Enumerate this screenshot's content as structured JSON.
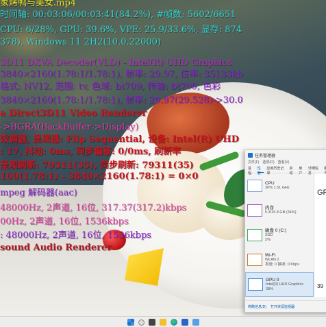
{
  "osd": {
    "lines": [
      {
        "text": "家烤鸭与美女.mp4",
        "color": "yellow"
      },
      {
        "text": "时间轴: 00:03:06/00:03:41(84.2%), #帧数: 5602/6651",
        "color": "cyan"
      },
      {
        "text": "CPU: 6/28%, GPU: 39.6%, VPE: 25.9/33.6%, 显存: 874",
        "color": "cyan"
      },
      {
        "text": "378), Windows 11 2H2(10.0.22000)",
        "color": "cyan"
      },
      {
        "text": "3D11 DXVA Decoder(VLD) - Intel(R) UHD Graphics",
        "color": "magenta"
      },
      {
        "text": "3840×2160(1.78:1/1.78:1), 帧率: 29.97, 位率: 35133kb",
        "color": "purple"
      },
      {
        "text": "格式: NV12, 范围: tv, 色域: bt709, 传输: bt709, 色彩",
        "color": "purple"
      },
      {
        "text": "3840×2160(1.78:1/1.78:1), 帧率: 29.97(29.528)->30.0",
        "color": "purple"
      },
      {
        "text": "a Direct3D11 Video Renderer",
        "color": "red"
      },
      {
        "text": "->BGRA(BackBuffer->Display)",
        "color": "pink"
      },
      {
        "text": "效调器, 呈现器: Flip Sequential, 设备: Intel(R) UHD",
        "color": "red"
      },
      {
        "text": ": 17, 抖动: 0ms, 同步偏移: 0/0ms, 刷新率",
        "color": "red"
      },
      {
        "text": "呈现刷新: 79311(35), 同步刷新: 79311(35)",
        "color": "red"
      },
      {
        "text": "160(1.78:1) - 3840×2160(1.78:1) = 0×0",
        "color": "red"
      },
      {
        "text": "mpeg 解码器(aac)",
        "color": "purple"
      },
      {
        "text": "48000Hz, 2声道, 16位, 317.37(317.2)kbps",
        "color": "pink"
      },
      {
        "text": "00Hz, 2声道, 16位, 1536kbps",
        "color": "pink"
      },
      {
        "text": ": 48000Hz, 2声道, 16位, 1536kbps",
        "color": "purple"
      },
      {
        "text": "sound Audio Renderer",
        "color": "dark"
      }
    ]
  },
  "task_manager": {
    "title": "任务管理器",
    "menu": [
      "文件(F)",
      "选项(O)",
      "查看(V)"
    ],
    "tabs": [
      "进程",
      "性能",
      "应用历史记录",
      "启动",
      "用户",
      "详细信息",
      "服务"
    ],
    "active_tab_index": 1,
    "items": [
      {
        "name": "CPU",
        "line2": "36% 1.51 GHz",
        "line3": ""
      },
      {
        "name": "内存",
        "line2": "5.3/15.8 GB (34%)",
        "line3": ""
      },
      {
        "name": "磁盘 0 (C:)",
        "line2": "SSD",
        "line3": "2%"
      },
      {
        "name": "Wi-Fi",
        "line2": "WLAN 2",
        "line3": "发送: 0 接收: 0 Kbps"
      },
      {
        "name": "GPU 0",
        "line2": "Intel(R) UHD Graphics",
        "line3": "39%"
      }
    ],
    "active_item_index": 4,
    "detail_title": "GPU",
    "detail_value": "39",
    "bottom": [
      "简略信息(D)",
      "打开资源监视器"
    ]
  },
  "taskbar": {
    "icons": [
      "start-icon",
      "search-icon",
      "task-view-icon",
      "file-explorer-icon",
      "edge-icon",
      "store-icon",
      "task-manager-icon"
    ]
  }
}
